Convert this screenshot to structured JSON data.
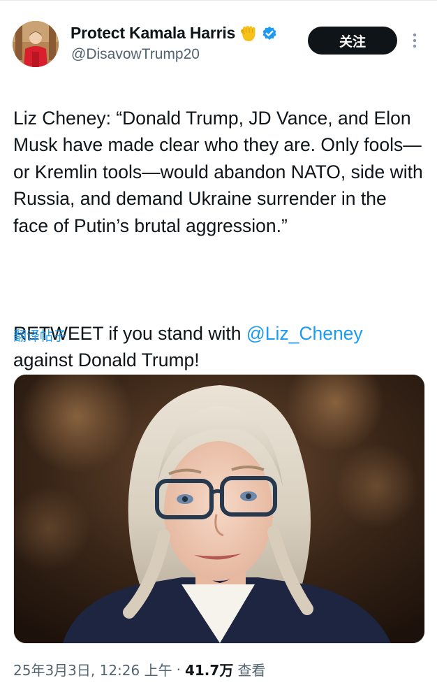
{
  "author": {
    "display_name": "Protect Kamala Harris",
    "handle": "@DisavowTrump20",
    "emoji_icon": "raised-fist-icon",
    "verified_icon": "verified-badge-icon",
    "verified_color": "#1d9bf0"
  },
  "follow_button": {
    "label": "关注"
  },
  "tweet": {
    "paragraph1": "Liz Cheney: “Donald Trump, JD Vance, and Elon Musk have made clear who they are. Only fools—or Kremlin tools—would abandon NATO, side with Russia, and demand Ukraine surrender in the face of Putin’s brutal aggression.”",
    "paragraph2_before": "RETWEET if you stand with ",
    "mention": "@Liz_Cheney",
    "paragraph2_after": " against Donald Trump!",
    "translate_label": "翻译帖子"
  },
  "meta": {
    "date_time": "25年3月3日, 12:26 上午",
    "separator": "·",
    "views_count": "41.7万",
    "views_label": "查看"
  },
  "colors": {
    "link": "#1d9bf0",
    "text": "#0f1419",
    "muted": "#536471"
  }
}
